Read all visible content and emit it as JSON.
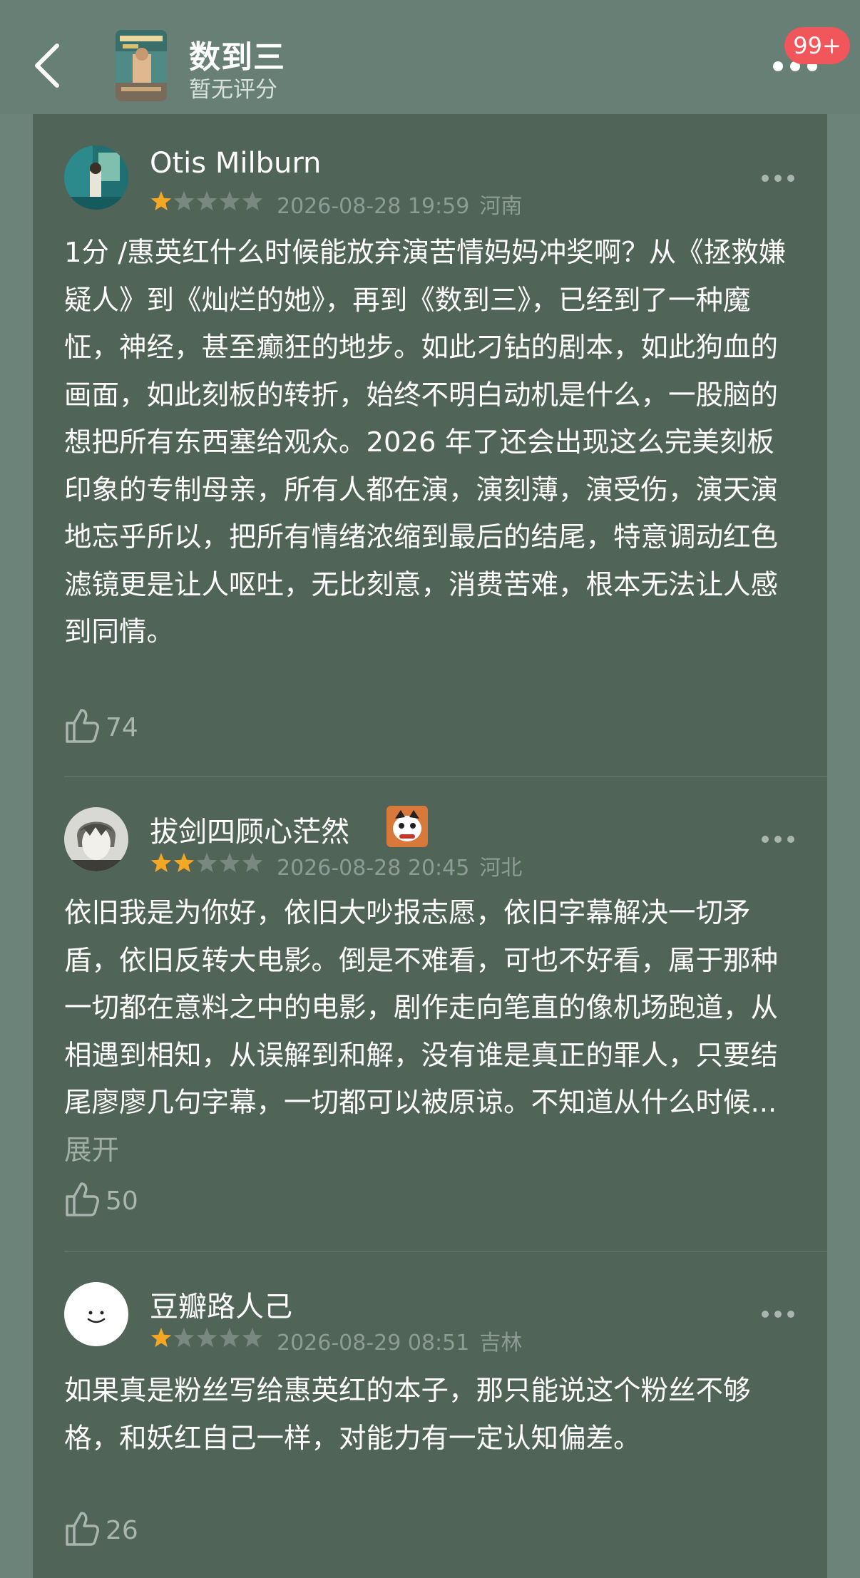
{
  "header": {
    "title": "数到三",
    "rating": "暂无评分",
    "badge": "99+"
  },
  "colors": {
    "header_bg": "#677f75",
    "panel_bg": "#506458",
    "star_on": "#f5a623",
    "star_off": "#7a8882",
    "badge": "#f0565a"
  },
  "reviews": [
    {
      "author": "Otis Milburn",
      "stars": 1,
      "date": "2026-08-28 19:59",
      "location": "河南",
      "text": "1分 /惠英红什么时候能放弃演苦情妈妈冲奖啊？从《拯救嫌疑人》到《灿烂的她》，再到《数到三》，已经到了一种魔怔，神经，甚至癫狂的地步。如此刁钻的剧本，如此狗血的画面，如此刻板的转折，始终不明白动机是什么，一股脑的想把所有东西塞给观众。2026 年了还会出现这么完美刻板印象的专制母亲，所有人都在演，演刻薄，演受伤，演天演地忘乎所以，把所有情绪浓缩到最后的结尾，特意调动红色滤镜更是让人呕吐，无比刻意，消费苦难，根本无法让人感到同情。",
      "likes": "74"
    },
    {
      "author": "拔剑四顾心茫然",
      "stars": 2,
      "date": "2026-08-28 20:45",
      "location": "河北",
      "text": "依旧我是为你好，依旧大吵报志愿，依旧字幕解决一切矛盾，依旧反转大电影。倒是不难看，可也不好看，属于那种一切都在意料之中的电影，剧作走向笔直的像机场跑道，从相遇到相知，从误解到和解，没有谁是真正的罪人，只要结尾廖廖几句字幕，一切都可以被原谅。不知道从什么时候...",
      "expand": "展开",
      "likes": "50"
    },
    {
      "author": "豆瓣路人己",
      "stars": 1,
      "date": "2026-08-29 08:51",
      "location": "吉林",
      "text": "如果真是粉丝写给惠英红的本子，那只能说这个粉丝不够格，和妖红自己一样，对能力有一定认知偏差。",
      "likes": "26"
    }
  ]
}
